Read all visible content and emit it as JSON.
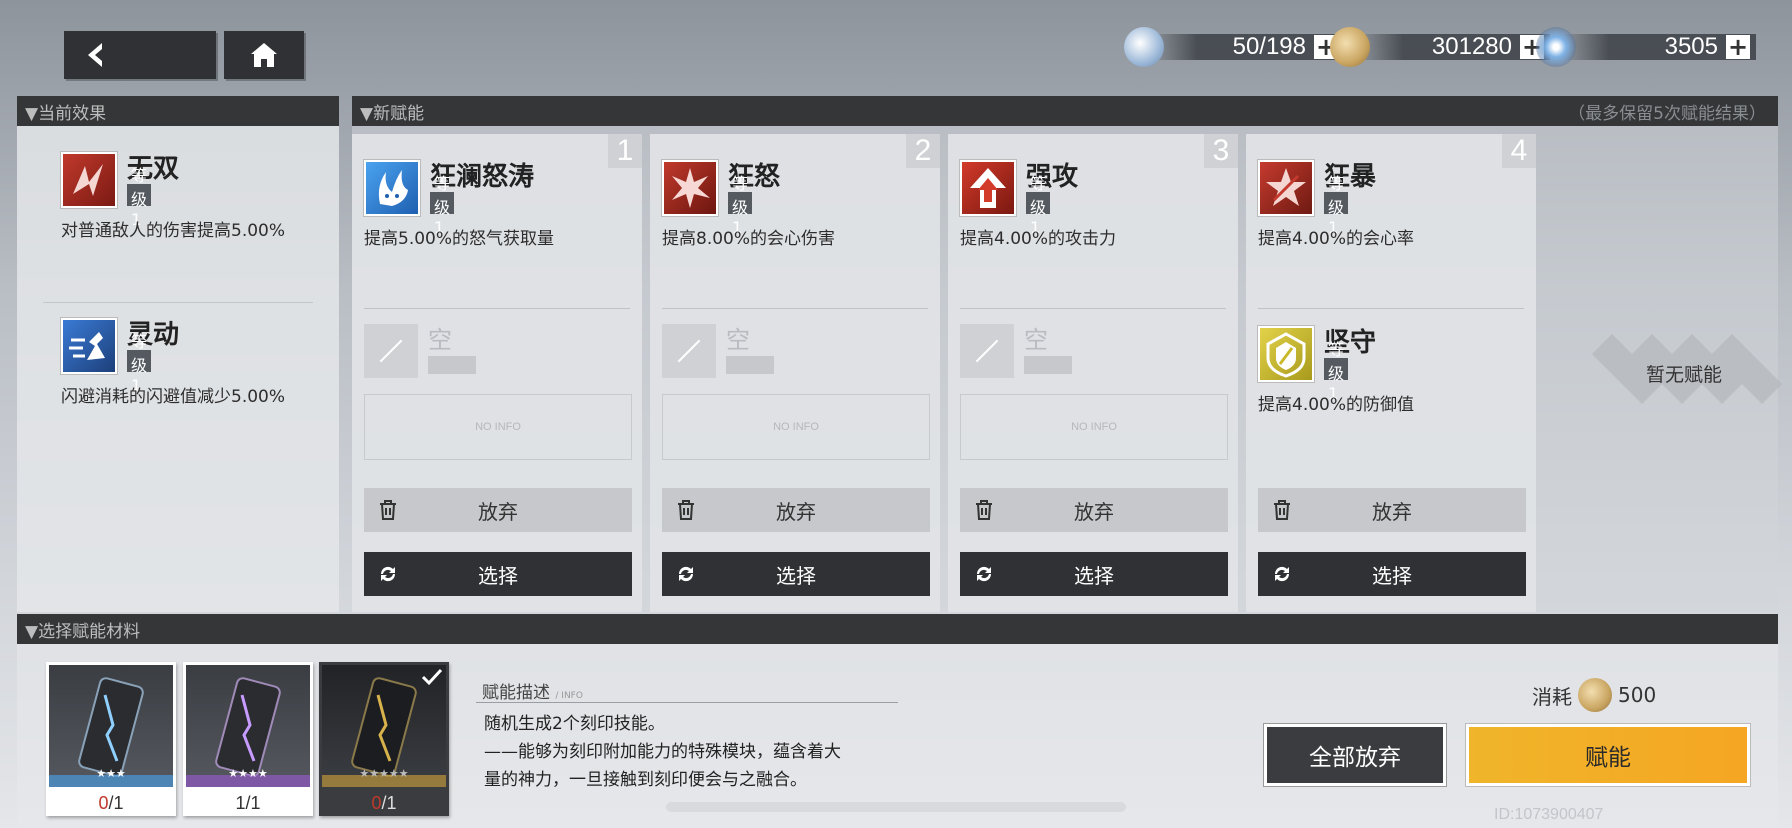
{
  "resources": {
    "fuel": "50/198",
    "coins": "301280",
    "crystals": "3505"
  },
  "current_effects": {
    "header": "▼当前效果",
    "items": [
      {
        "name": "无双",
        "level": "等级1",
        "desc": "对普通敌人的伤害提高5.00%"
      },
      {
        "name": "灵动",
        "level": "等级1",
        "desc": "闪避消耗的闪避值减少5.00%"
      }
    ]
  },
  "new_talents": {
    "header": "▼新赋能",
    "note": "（最多保留5次赋能结果）",
    "cards": [
      {
        "num": "1",
        "name": "狂澜怒涛",
        "level": "等级1",
        "desc": "提高5.00%的怒气获取量",
        "slot2_empty": "空",
        "noinfo": "NO INFO",
        "abandon": "放弃",
        "select": "选择"
      },
      {
        "num": "2",
        "name": "狂怒",
        "level": "等级1",
        "desc": "提高8.00%的会心伤害",
        "slot2_empty": "空",
        "noinfo": "NO INFO",
        "abandon": "放弃",
        "select": "选择"
      },
      {
        "num": "3",
        "name": "强攻",
        "level": "等级1",
        "desc": "提高4.00%的攻击力",
        "slot2_empty": "空",
        "noinfo": "NO INFO",
        "abandon": "放弃",
        "select": "选择"
      },
      {
        "num": "4",
        "name": "狂暴",
        "level": "等级1",
        "desc": "提高4.00%的会心率",
        "slot2_name": "坚守",
        "slot2_level": "等级1",
        "slot2_desc": "提高4.00%的防御值",
        "abandon": "放弃",
        "select": "选择"
      }
    ],
    "empty_state": "暂无赋能"
  },
  "materials": {
    "header": "▼选择赋能材料",
    "items": [
      {
        "have": "0",
        "need": "/1",
        "stars": "★★★"
      },
      {
        "have": "1",
        "need": "/1",
        "stars": "★★★★"
      },
      {
        "have": "0",
        "need": "/1",
        "stars": "★★★★★"
      }
    ]
  },
  "description": {
    "title": "赋能描述",
    "subtitle": "/ INFO",
    "line1": "随机生成2个刻印技能。",
    "line2": "——能够为刻印附加能力的特殊模块，蕴含着大",
    "line3": "量的神力，一旦接触到刻印便会与之融合。"
  },
  "cost": {
    "label": "消耗",
    "value": "500"
  },
  "buttons": {
    "abandon_all": "全部放弃",
    "fuse": "赋能"
  },
  "footer_id": "ID:1073900407"
}
